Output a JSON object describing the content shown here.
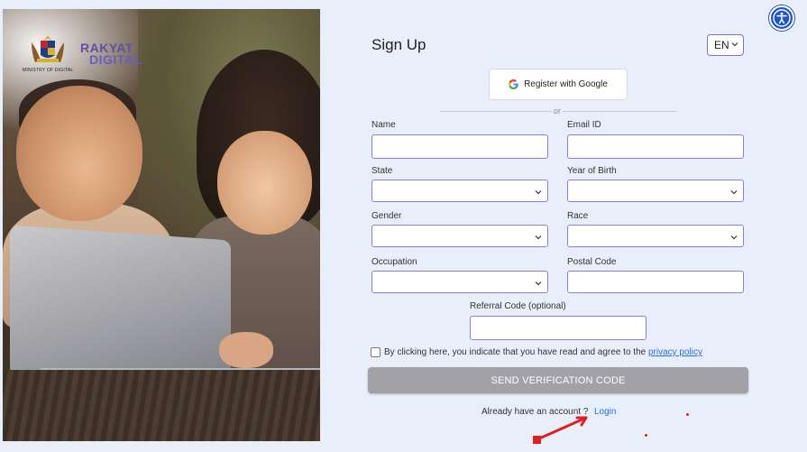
{
  "header": {
    "brand_line1": "RAKYAT",
    "brand_line2": "DIGITAL",
    "ministry": "MINISTRY OF DIGITAL"
  },
  "form": {
    "title": "Sign Up",
    "language": "EN",
    "google_label": "Register with Google",
    "or_label": "or",
    "fields": {
      "name": "Name",
      "email": "Email ID",
      "state": "State",
      "year_of_birth": "Year of Birth",
      "gender": "Gender",
      "race": "Race",
      "occupation": "Occupation",
      "postal_code": "Postal Code",
      "referral": "Referral Code (optional)"
    },
    "agree_text": "By clicking here, you indicate that you have read and agree to the",
    "privacy_link": "privacy policy",
    "send_label": "SEND VERIFICATION CODE",
    "already_text": "Already have an account ?",
    "login_label": "Login"
  },
  "icons": {
    "accessibility": "accessibility-icon",
    "google": "google-icon",
    "chevron": "chevron-down-icon"
  },
  "colors": {
    "accent": "#8a7fd1",
    "link": "#2b6de0",
    "button_disabled": "#a2a2a6",
    "background": "#e9eefb"
  }
}
